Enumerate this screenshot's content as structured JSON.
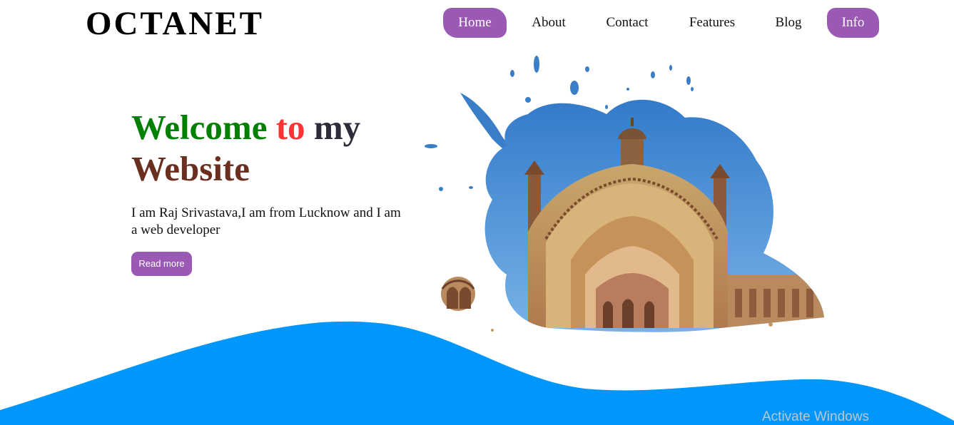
{
  "brand": {
    "logo": "OCTANET"
  },
  "nav": {
    "items": [
      {
        "label": "Home"
      },
      {
        "label": "About"
      },
      {
        "label": "Contact"
      },
      {
        "label": "Features"
      },
      {
        "label": "Blog"
      },
      {
        "label": "Info"
      }
    ]
  },
  "hero": {
    "title_word1": "Welcome",
    "title_word2": "to",
    "title_word3": "my",
    "title_word4": "Website",
    "description": "I am Raj Srivastava,I am from Lucknow and I am a web developer",
    "button_label": "Read more"
  },
  "watermark": "Activate Windows",
  "colors": {
    "accent_purple": "#9b59b6",
    "title_green": "#008000",
    "title_red": "#ff3333",
    "title_dark": "#2c2c3a",
    "title_brown": "#6b2f1f",
    "wave_blue": "#0097fc",
    "sky_blue": "#3f8fd6"
  }
}
